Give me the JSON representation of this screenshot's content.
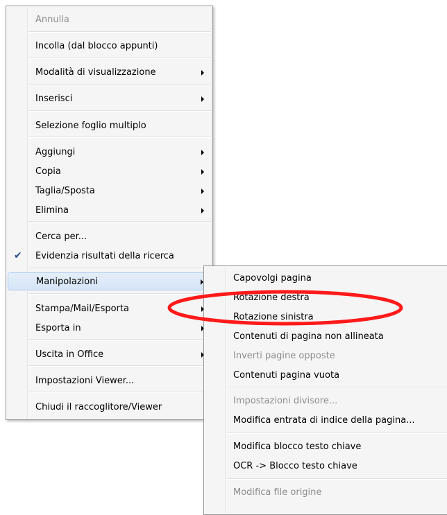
{
  "main_menu": {
    "items": [
      {
        "label": "Annulla",
        "disabled": true
      },
      {
        "label": "Incolla (dal blocco appunti)"
      },
      {
        "label": "Modalità di visualizzazione",
        "submenu": true
      },
      {
        "label": "Inserisci",
        "submenu": true
      },
      {
        "label": "Selezione foglio multiplo"
      },
      {
        "label": "Aggiungi",
        "submenu": true
      },
      {
        "label": "Copia",
        "submenu": true
      },
      {
        "label": "Taglia/Sposta",
        "submenu": true
      },
      {
        "label": "Elimina",
        "submenu": true
      },
      {
        "label": "Cerca per..."
      },
      {
        "label": "Evidenzia risultati della ricerca",
        "checked": true
      },
      {
        "label": "Manipolazioni",
        "submenu": true,
        "highlighted": true
      },
      {
        "label": "Stampa/Mail/Esporta",
        "submenu": true
      },
      {
        "label": "Esporta in",
        "submenu": true
      },
      {
        "label": "Uscita in Office",
        "submenu": true
      },
      {
        "label": "Impostazioni Viewer..."
      },
      {
        "label": "Chiudi il raccoglitore/Viewer"
      }
    ]
  },
  "sub_menu": {
    "items": [
      {
        "label": "Capovolgi pagina"
      },
      {
        "label": "Rotazione destra"
      },
      {
        "label": "Rotazione sinistra"
      },
      {
        "label": "Contenuti di pagina non allineata"
      },
      {
        "label": "Inverti pagine opposte",
        "disabled": true
      },
      {
        "label": "Contenuti pagina vuota"
      },
      {
        "label": "Impostazioni divisore...",
        "disabled": true
      },
      {
        "label": "Modifica entrata di indice della pagina..."
      },
      {
        "label": "Modifica blocco testo chiave"
      },
      {
        "label": "OCR -> Blocco testo chiave"
      },
      {
        "label": "Modifica file origine",
        "disabled": true
      }
    ]
  },
  "colors": {
    "annotation": "#ff1a1a",
    "check": "#2a4f8c",
    "disabled_text": "#8d8d8d",
    "highlight": "#d5e5f7"
  }
}
